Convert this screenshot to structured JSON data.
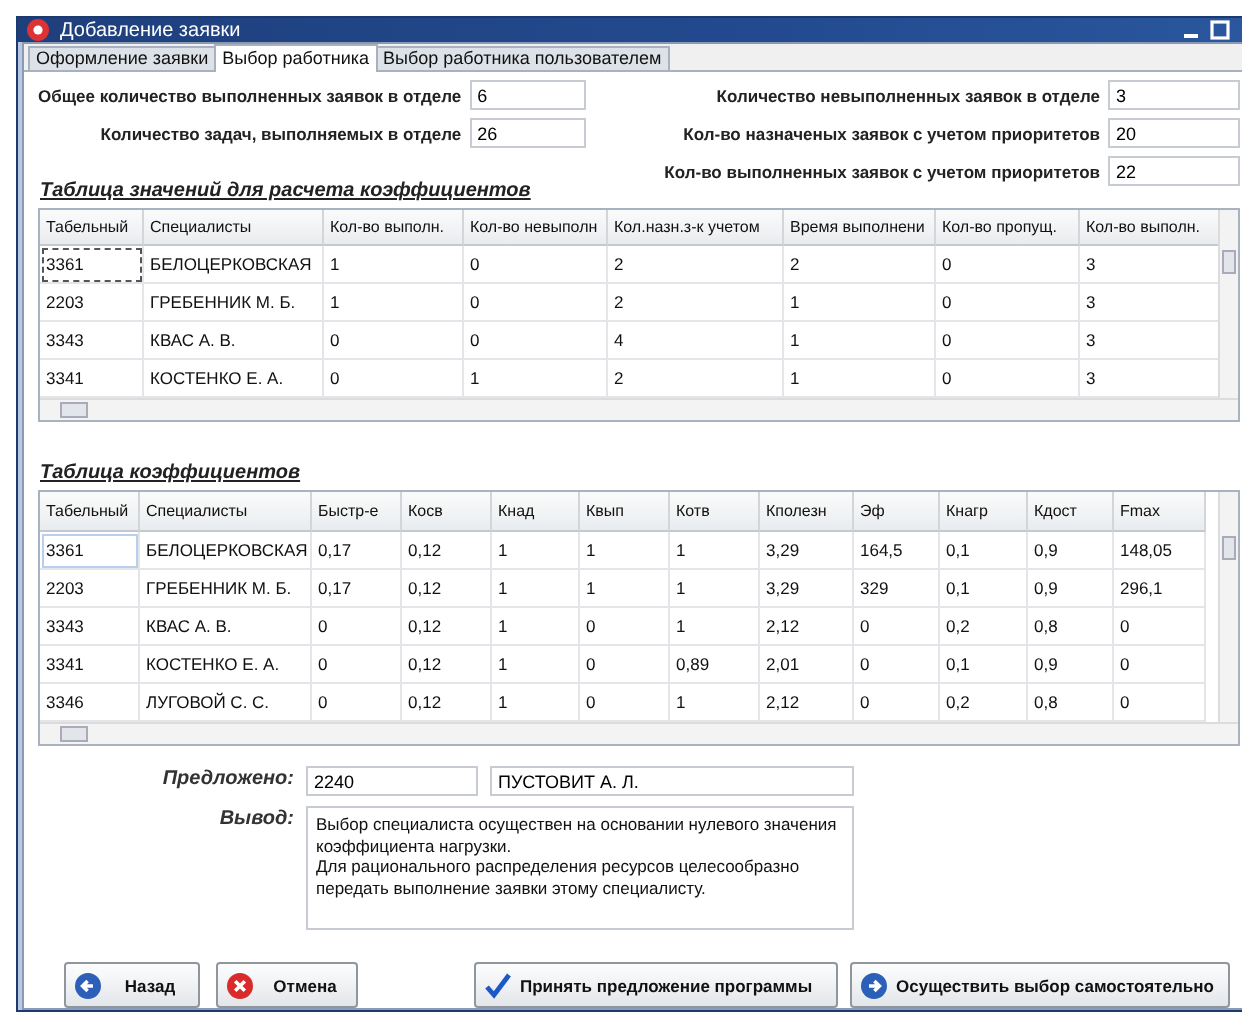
{
  "window": {
    "title": "Добавление заявки"
  },
  "tabs": [
    {
      "label": "Оформление заявки",
      "selected": false
    },
    {
      "label": "Выбор работника",
      "selected": true
    },
    {
      "label": "Выбор работника пользователем",
      "selected": false
    }
  ],
  "stats_left": [
    {
      "label": "Общее количество выполненных заявок в отделе",
      "value": "6"
    },
    {
      "label": "Количество задач, выполняемых в отделе",
      "value": "26"
    }
  ],
  "stats_right": [
    {
      "label": "Количество невыполненных заявок в отделе",
      "value": "3"
    },
    {
      "label": "Кол-во назначеных заявок с учетом приоритетов",
      "value": "20"
    },
    {
      "label": "Кол-во выполненных заявок с учетом приоритетов",
      "value": "22"
    }
  ],
  "values_table": {
    "title": "Таблица значений для расчета коэффициентов",
    "columns": [
      "Табельный",
      "Специалисты",
      "Кол-во выполн.",
      "Кол-во невыполн",
      "Кол.назн.з-к учетом",
      "Время выполнени",
      "Кол-во пропущ.",
      "Кол-во выполн."
    ],
    "rows": [
      [
        "3361",
        "БЕЛОЦЕРКОВСКАЯ",
        "1",
        "0",
        "2",
        "2",
        "0",
        "3"
      ],
      [
        "2203",
        "ГРЕБЕННИК М. Б.",
        "1",
        "0",
        "2",
        "1",
        "0",
        "3"
      ],
      [
        "3343",
        "КВАС А. В.",
        "0",
        "0",
        "4",
        "1",
        "0",
        "3"
      ],
      [
        "3341",
        "КОСТЕНКО Е. А.",
        "0",
        "1",
        "2",
        "1",
        "0",
        "3"
      ]
    ]
  },
  "coefficients_table": {
    "title": "Таблица коэффициентов",
    "columns": [
      "Табельный",
      "Специалисты",
      "Быстр-е",
      "Косв",
      "Кнад",
      "Квып",
      "Котв",
      "Кполезн",
      "Эф",
      "Кнагр",
      "Кдост",
      "Fmax"
    ],
    "rows": [
      [
        "3361",
        "БЕЛОЦЕРКОВСКАЯ",
        "0,17",
        "0,12",
        "1",
        "1",
        "1",
        "3,29",
        "164,5",
        "0,1",
        "0,9",
        "148,05"
      ],
      [
        "2203",
        "ГРЕБЕННИК М. Б.",
        "0,17",
        "0,12",
        "1",
        "1",
        "1",
        "3,29",
        "329",
        "0,1",
        "0,9",
        "296,1"
      ],
      [
        "3343",
        "КВАС А. В.",
        "0",
        "0,12",
        "1",
        "0",
        "1",
        "2,12",
        "0",
        "0,2",
        "0,8",
        "0"
      ],
      [
        "3341",
        "КОСТЕНКО Е. А.",
        "0",
        "0,12",
        "1",
        "0",
        "0,89",
        "2,01",
        "0",
        "0,1",
        "0,9",
        "0"
      ],
      [
        "3346",
        "ЛУГОВОЙ С. С.",
        "0",
        "0,12",
        "1",
        "0",
        "1",
        "2,12",
        "0",
        "0,2",
        "0,8",
        "0"
      ]
    ]
  },
  "proposal": {
    "label": "Предложено:",
    "id": "2240",
    "name": "ПУСТОВИТ А. Л."
  },
  "conclusion": {
    "label": "Вывод:",
    "text": "Выбор специалиста осуществен на основании нулевого значения\nкоэффициента нагрузки.\nДля рационального распределения ресурсов целесообразно\nпередать выполнение заявки этому специалисту."
  },
  "buttons": [
    {
      "label": "Назад",
      "kind": "back"
    },
    {
      "label": "Отмена",
      "kind": "cancel"
    },
    {
      "label": "Принять предложение программы",
      "kind": "accept"
    },
    {
      "label": "Осуществить выбор самостоятельно",
      "kind": "forward"
    }
  ]
}
